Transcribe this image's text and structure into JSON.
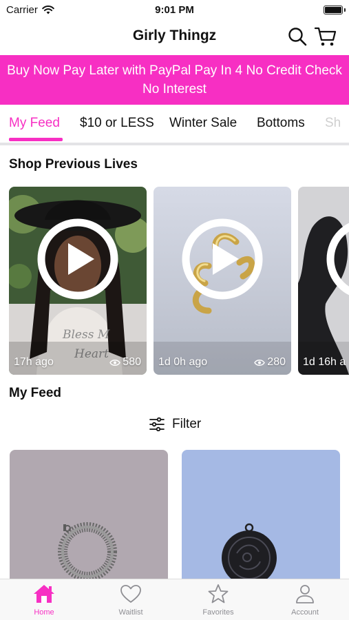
{
  "status_bar": {
    "carrier": "Carrier",
    "time": "9:01 PM"
  },
  "header": {
    "title": "Girly Thingz",
    "search_icon": "search-icon",
    "cart_icon": "cart-icon"
  },
  "promo": {
    "line1": "Buy Now Pay Later with PayPal Pay In 4 No Credit Check",
    "line2": "No Interest"
  },
  "tabs": [
    {
      "label": "My Feed",
      "active": true
    },
    {
      "label": "$10 or LESS"
    },
    {
      "label": "Winter Sale"
    },
    {
      "label": "Bottoms"
    },
    {
      "label": "Sh"
    }
  ],
  "sections": {
    "previous_lives": "Shop Previous Lives",
    "my_feed": "My Feed"
  },
  "lives": [
    {
      "time": "17h ago",
      "views": "580"
    },
    {
      "time": "1d 0h ago",
      "views": "280"
    },
    {
      "time": "1d 16h a",
      "views": ""
    }
  ],
  "filter": {
    "label": "Filter",
    "icon": "sliders-icon"
  },
  "bottom_tabs": [
    {
      "label": "Home",
      "icon": "home-icon",
      "active": true
    },
    {
      "label": "Waitlist",
      "icon": "heart-icon"
    },
    {
      "label": "Favorites",
      "icon": "star-icon"
    },
    {
      "label": "Account",
      "icon": "person-icon"
    }
  ],
  "colors": {
    "accent": "#f72fc3",
    "divider": "#e3e3e6",
    "tab_inactive": "#8e8e93"
  }
}
